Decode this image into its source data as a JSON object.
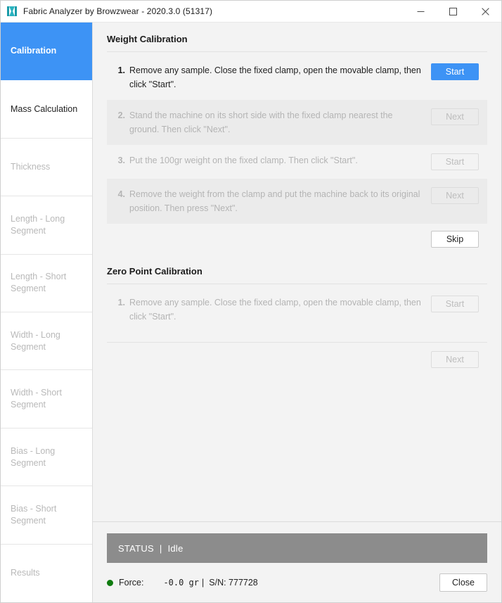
{
  "window": {
    "title": "Fabric Analyzer by Browzwear - 2020.3.0 (51317)",
    "app_icon": "fabric-roll-icon",
    "minimize_label": "–",
    "maximize_label": "❑",
    "close_label": "✕",
    "accent_color": "#3d93f5",
    "status_bar_color": "#8c8c8c",
    "ok_dot_color": "#0e7b0e"
  },
  "sidebar": {
    "items": [
      {
        "label": "Calibration",
        "state": "active"
      },
      {
        "label": "Mass Calculation",
        "state": "enabled"
      },
      {
        "label": "Thickness",
        "state": "disabled"
      },
      {
        "label": "Length - Long Segment",
        "state": "disabled"
      },
      {
        "label": "Length - Short Segment",
        "state": "disabled"
      },
      {
        "label": "Width - Long Segment",
        "state": "disabled"
      },
      {
        "label": "Width - Short Segment",
        "state": "disabled"
      },
      {
        "label": "Bias - Long Segment",
        "state": "disabled"
      },
      {
        "label": "Bias - Short Segment",
        "state": "disabled"
      },
      {
        "label": "Results",
        "state": "disabled"
      }
    ]
  },
  "weight_calibration": {
    "title": "Weight Calibration",
    "steps": [
      {
        "num": "1.",
        "text": "Remove any sample. Close the fixed clamp, open the movable clamp, then click \"Start\".",
        "button": "Start",
        "button_state": "primary",
        "shaded": false
      },
      {
        "num": "2.",
        "text": "Stand the machine on its short side with the fixed clamp nearest the ground. Then click \"Next\".",
        "button": "Next",
        "button_state": "disabled",
        "shaded": true
      },
      {
        "num": "3.",
        "text": "Put the 100gr weight on the fixed clamp. Then click \"Start\".",
        "button": "Start",
        "button_state": "disabled",
        "shaded": false
      },
      {
        "num": "4.",
        "text": "Remove the weight from the clamp and put the machine back to its original position. Then press \"Next\".",
        "button": "Next",
        "button_state": "disabled",
        "shaded": true
      }
    ],
    "skip_button": "Skip"
  },
  "zero_point_calibration": {
    "title": "Zero Point Calibration",
    "steps": [
      {
        "num": "1.",
        "text": "Remove any sample. Close the fixed clamp, open the movable clamp, then click \"Start\".",
        "button": "Start",
        "button_state": "disabled",
        "shaded": false
      }
    ],
    "next_button": "Next"
  },
  "status": {
    "label": "STATUS",
    "separator": "|",
    "value": "Idle"
  },
  "footer": {
    "force_label": "Force:",
    "force_value": "-0.0 gr",
    "separator": "|",
    "serial_number": "S/N: 777728",
    "close_button": "Close"
  }
}
